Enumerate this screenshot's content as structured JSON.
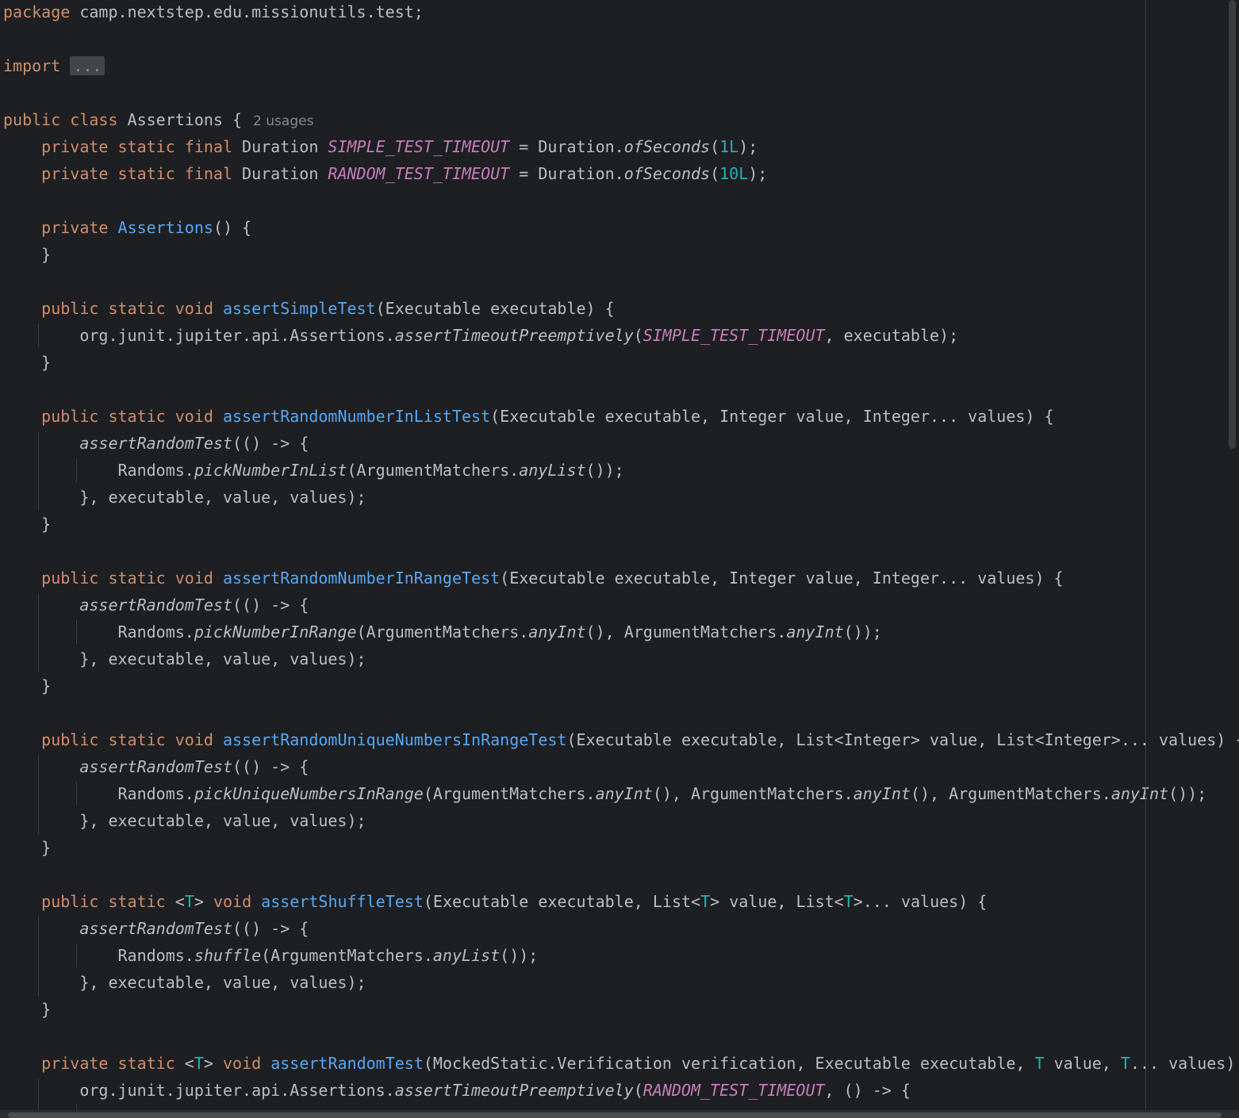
{
  "editor": {
    "language": "java",
    "colors": {
      "background": "#1e1f22",
      "text": "#bcbec4",
      "keyword": "#cf8e6d",
      "function": "#56a8f5",
      "constant": "#c77dbb",
      "number": "#2aacb8",
      "type_param": "#16baac",
      "inlay_hint": "#868a91"
    },
    "lines": [
      [
        {
          "t": "package",
          "c": "kw"
        },
        {
          "t": " camp.nextstep.edu.missionutils.test;"
        }
      ],
      [],
      [
        {
          "t": "import",
          "c": "kw"
        },
        {
          "t": " "
        },
        {
          "t": "...",
          "c": "fold"
        }
      ],
      [],
      [
        {
          "t": "public class",
          "c": "kw"
        },
        {
          "t": " Assertions {"
        },
        {
          "t": "2 usages",
          "c": "hint"
        }
      ],
      [
        {
          "t": "    "
        },
        {
          "t": "private static final",
          "c": "kw"
        },
        {
          "t": " Duration "
        },
        {
          "t": "SIMPLE_TEST_TIMEOUT",
          "c": "cst"
        },
        {
          "t": " = Duration."
        },
        {
          "t": "ofSeconds",
          "c": "it"
        },
        {
          "t": "("
        },
        {
          "t": "1L",
          "c": "num"
        },
        {
          "t": ");"
        }
      ],
      [
        {
          "t": "    "
        },
        {
          "t": "private static final",
          "c": "kw"
        },
        {
          "t": " Duration "
        },
        {
          "t": "RANDOM_TEST_TIMEOUT",
          "c": "cst"
        },
        {
          "t": " = Duration."
        },
        {
          "t": "ofSeconds",
          "c": "it"
        },
        {
          "t": "("
        },
        {
          "t": "10L",
          "c": "num"
        },
        {
          "t": ");"
        }
      ],
      [],
      [
        {
          "t": "    "
        },
        {
          "t": "private",
          "c": "kw"
        },
        {
          "t": " "
        },
        {
          "t": "Assertions",
          "c": "fn"
        },
        {
          "t": "() {"
        }
      ],
      [
        {
          "t": "    }"
        }
      ],
      [],
      [
        {
          "t": "    "
        },
        {
          "t": "public static void",
          "c": "kw"
        },
        {
          "t": " "
        },
        {
          "t": "assertSimpleTest",
          "c": "fn"
        },
        {
          "t": "(Executable executable) {"
        }
      ],
      [
        {
          "t": "        org.junit.jupiter.api.Assertions."
        },
        {
          "t": "assertTimeoutPreemptively",
          "c": "it"
        },
        {
          "t": "("
        },
        {
          "t": "SIMPLE_TEST_TIMEOUT",
          "c": "cst"
        },
        {
          "t": ", executable);"
        }
      ],
      [
        {
          "t": "    }"
        }
      ],
      [],
      [
        {
          "t": "    "
        },
        {
          "t": "public static void",
          "c": "kw"
        },
        {
          "t": " "
        },
        {
          "t": "assertRandomNumberInListTest",
          "c": "fn"
        },
        {
          "t": "(Executable executable, Integer value, Integer... values) {"
        }
      ],
      [
        {
          "t": "        "
        },
        {
          "t": "assertRandomTest",
          "c": "it"
        },
        {
          "t": "(() -> {"
        }
      ],
      [
        {
          "t": "            Randoms."
        },
        {
          "t": "pickNumberInList",
          "c": "it"
        },
        {
          "t": "(ArgumentMatchers."
        },
        {
          "t": "anyList",
          "c": "it"
        },
        {
          "t": "());"
        }
      ],
      [
        {
          "t": "        }, executable, value, values);"
        }
      ],
      [
        {
          "t": "    }"
        }
      ],
      [],
      [
        {
          "t": "    "
        },
        {
          "t": "public static void",
          "c": "kw"
        },
        {
          "t": " "
        },
        {
          "t": "assertRandomNumberInRangeTest",
          "c": "fn"
        },
        {
          "t": "(Executable executable, Integer value, Integer... values) {"
        }
      ],
      [
        {
          "t": "        "
        },
        {
          "t": "assertRandomTest",
          "c": "it"
        },
        {
          "t": "(() -> {"
        }
      ],
      [
        {
          "t": "            Randoms."
        },
        {
          "t": "pickNumberInRange",
          "c": "it"
        },
        {
          "t": "(ArgumentMatchers."
        },
        {
          "t": "anyInt",
          "c": "it"
        },
        {
          "t": "(), ArgumentMatchers."
        },
        {
          "t": "anyInt",
          "c": "it"
        },
        {
          "t": "());"
        }
      ],
      [
        {
          "t": "        }, executable, value, values);"
        }
      ],
      [
        {
          "t": "    }"
        }
      ],
      [],
      [
        {
          "t": "    "
        },
        {
          "t": "public static void",
          "c": "kw"
        },
        {
          "t": " "
        },
        {
          "t": "assertRandomUniqueNumbersInRangeTest",
          "c": "fn"
        },
        {
          "t": "(Executable executable, List<Integer> value, List<Integer>... values) {"
        }
      ],
      [
        {
          "t": "        "
        },
        {
          "t": "assertRandomTest",
          "c": "it"
        },
        {
          "t": "(() -> {"
        }
      ],
      [
        {
          "t": "            Randoms."
        },
        {
          "t": "pickUniqueNumbersInRange",
          "c": "it"
        },
        {
          "t": "(ArgumentMatchers."
        },
        {
          "t": "anyInt",
          "c": "it"
        },
        {
          "t": "(), ArgumentMatchers."
        },
        {
          "t": "anyInt",
          "c": "it"
        },
        {
          "t": "(), ArgumentMatchers."
        },
        {
          "t": "anyInt",
          "c": "it"
        },
        {
          "t": "());"
        }
      ],
      [
        {
          "t": "        }, executable, value, values);"
        }
      ],
      [
        {
          "t": "    }"
        }
      ],
      [],
      [
        {
          "t": "    "
        },
        {
          "t": "public static",
          "c": "kw"
        },
        {
          "t": " <"
        },
        {
          "t": "T",
          "c": "tp"
        },
        {
          "t": "> "
        },
        {
          "t": "void",
          "c": "kw"
        },
        {
          "t": " "
        },
        {
          "t": "assertShuffleTest",
          "c": "fn"
        },
        {
          "t": "(Executable executable, List<"
        },
        {
          "t": "T",
          "c": "tp"
        },
        {
          "t": "> value, List<"
        },
        {
          "t": "T",
          "c": "tp"
        },
        {
          "t": ">... values) {"
        }
      ],
      [
        {
          "t": "        "
        },
        {
          "t": "assertRandomTest",
          "c": "it"
        },
        {
          "t": "(() -> {"
        }
      ],
      [
        {
          "t": "            Randoms."
        },
        {
          "t": "shuffle",
          "c": "it"
        },
        {
          "t": "(ArgumentMatchers."
        },
        {
          "t": "anyList",
          "c": "it"
        },
        {
          "t": "());"
        }
      ],
      [
        {
          "t": "        }, executable, value, values);"
        }
      ],
      [
        {
          "t": "    }"
        }
      ],
      [],
      [
        {
          "t": "    "
        },
        {
          "t": "private static",
          "c": "kw"
        },
        {
          "t": " <"
        },
        {
          "t": "T",
          "c": "tp"
        },
        {
          "t": "> "
        },
        {
          "t": "void",
          "c": "kw"
        },
        {
          "t": " "
        },
        {
          "t": "assertRandomTest",
          "c": "fn"
        },
        {
          "t": "(MockedStatic.Verification verification, Executable executable, "
        },
        {
          "t": "T",
          "c": "tp"
        },
        {
          "t": " value, "
        },
        {
          "t": "T",
          "c": "tp"
        },
        {
          "t": "... values)"
        }
      ],
      [
        {
          "t": "        org.junit.jupiter.api.Assertions."
        },
        {
          "t": "assertTimeoutPreemptively",
          "c": "it"
        },
        {
          "t": "("
        },
        {
          "t": "RANDOM_TEST_TIMEOUT",
          "c": "cst"
        },
        {
          "t": ", () -> {"
        }
      ]
    ]
  }
}
